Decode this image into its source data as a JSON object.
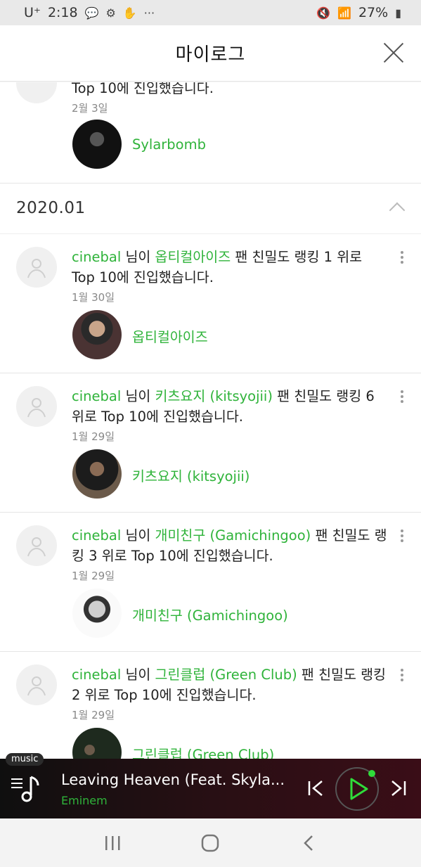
{
  "status_bar": {
    "carrier": "U⁺",
    "time": "2:18",
    "battery": "27%",
    "notif_icons": [
      "talk-icon",
      "settings-icon",
      "vpn-icon",
      "more-icon"
    ]
  },
  "header": {
    "title": "마이로그"
  },
  "feed_top": {
    "text_tail": "Top 10에 진입했습니다.",
    "date": "2월 3일",
    "artist": "Sylarbomb"
  },
  "section": {
    "month": "2020.01"
  },
  "items": [
    {
      "user": "cinebal",
      "mid": " 님이 ",
      "artist": "옵티컬아이즈",
      "tail": " 팬 친밀도 랭킹 1 위로 Top 10에 진입했습니다.",
      "date": "1월 30일",
      "artist_card": "옵티컬아이즈"
    },
    {
      "user": "cinebal",
      "mid": " 님이 ",
      "artist": "키츠요지 (kitsyojii)",
      "tail": " 팬 친밀도 랭킹 6 위로 Top 10에 진입했습니다.",
      "date": "1월 29일",
      "artist_card": "키츠요지 (kitsyojii)"
    },
    {
      "user": "cinebal",
      "mid": " 님이 ",
      "artist": "개미친구 (Gamichingoo)",
      "tail": " 팬 친밀도 랭킹 3 위로 Top 10에 진입했습니다.",
      "date": "1월 29일",
      "artist_card": "개미친구 (Gamichingoo)"
    },
    {
      "user": "cinebal",
      "mid": " 님이 ",
      "artist": "그린클럽 (Green Club)",
      "tail": " 팬 친밀도 랭킹 2 위로 Top 10에 진입했습니다.",
      "date": "1월 29일",
      "artist_card": "그린클럽 (Green Club)"
    }
  ],
  "player": {
    "tag": "music",
    "title": "Leaving Heaven (Feat. Skyla...",
    "artist": "Eminem"
  },
  "colors": {
    "accent": "#2fb33a",
    "player_bg": "#2a0f14"
  }
}
